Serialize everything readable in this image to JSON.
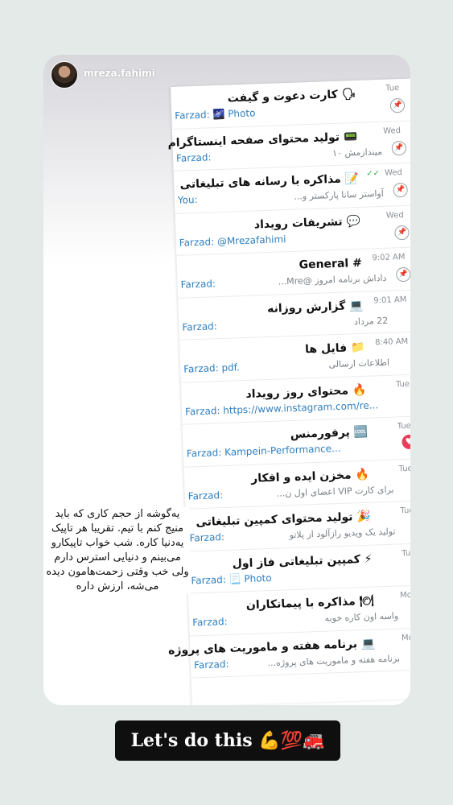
{
  "story": {
    "username": "mreza.fahimi",
    "caption": "یه‌گوشه از حجم کاری که باید منیج کنم با تیم. تقریبا هر تاپیک یه‌دنیا کاره. شب خواب تاپیکارو می‌بینم و دنیایی استرس دارم ولی خب وقتی زحمت‌هامون دیده می‌شه، ارزش داره",
    "cta": "Let's do this 💪💯🚒"
  },
  "chats": [
    {
      "time": "Tue",
      "title": "🗣 کارت دعوت و گیفت",
      "sender": "Farzad: 🌌 Photo",
      "preview": "",
      "badge": "pin"
    },
    {
      "time": "Wed",
      "title": "📟 تولید محتوای صفحه اینستاگرام",
      "sender": "Farzad:",
      "preview": "میندازمش ۱۰",
      "badge": "pin"
    },
    {
      "time": "Wed",
      "title": "📝 مذاکره با رسانه های تبلیغاتی",
      "sender": "You:",
      "preview": "آواستر سانا پارکستر و...",
      "badge": "pin",
      "check": "✓✓"
    },
    {
      "time": "Wed",
      "title": "💬 تشریفات رویداد",
      "sender": "Farzad: @Mrezafahimi",
      "preview": "",
      "badge": "pin"
    },
    {
      "time": "9:02 AM",
      "title": "# General",
      "sender": "Farzad:",
      "preview": "داداش برنامه امروز @Mre...",
      "badge": "pin"
    },
    {
      "time": "9:01 AM",
      "title": "💻 گزارش روزانه",
      "sender": "Farzad:",
      "preview": "22 مرداد",
      "badge": ""
    },
    {
      "time": "8:40 AM",
      "title": "📁 فایل ها",
      "sender": "Farzad: pdf.",
      "preview": "اطلاعات ارسالی",
      "badge": ""
    },
    {
      "time": "Tue",
      "title": "🔥 محتوای روز رویداد",
      "sender": "Farzad: https://www.instagram.com/re...",
      "preview": "",
      "badge": ""
    },
    {
      "time": "Tue",
      "title": "🆒 پرفورمنس",
      "sender": "Farzad: Kampein-Performance...",
      "preview": "",
      "badge": "heart"
    },
    {
      "time": "Tue",
      "title": "🔥 مخزن ایده و افکار",
      "sender": "Farzad:",
      "preview": "برای کارت VIP اعضای اول ن...",
      "badge": ""
    },
    {
      "time": "Tue",
      "title": "🎉 تولید محتوای کمپین تبلیغاتی",
      "sender": "Farzad:",
      "preview": "تولید یک ویدیو رازآلود از پلاتو",
      "badge": ""
    },
    {
      "time": "Tue",
      "title": "⚡ کمپین تبلیغاتی فاز اول",
      "sender": "Farzad: 📃 Photo",
      "preview": "",
      "badge": ""
    },
    {
      "time": "Mon",
      "title": "🍽 مذاکره با پیمانکاران",
      "sender": "Farzad:",
      "preview": "واسه اون کاره خوبه",
      "badge": ""
    },
    {
      "time": "Mon",
      "title": "💻 برنامه هفته و ماموریت های پروژه",
      "sender": "Farzad:",
      "preview": "برنامه هفته و ماموریت های پروژه...",
      "badge": ""
    }
  ]
}
